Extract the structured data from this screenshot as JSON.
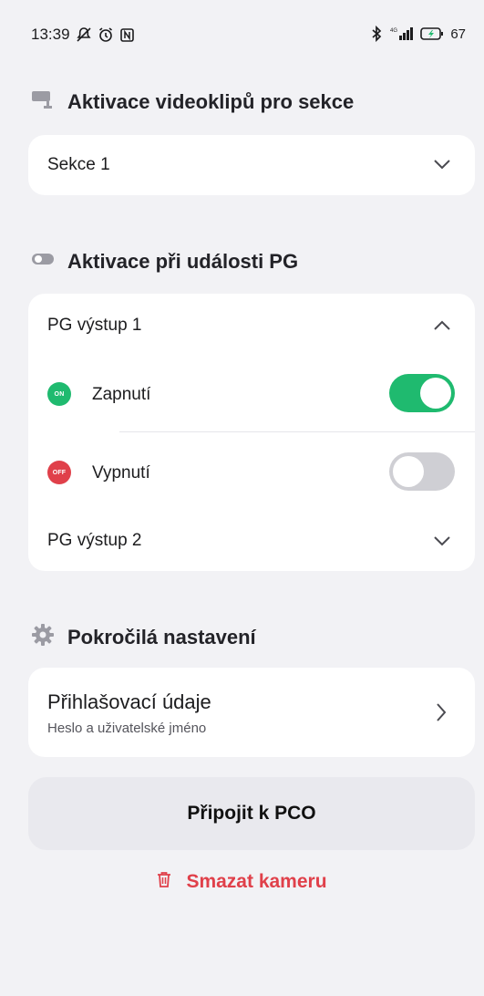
{
  "status_bar": {
    "time": "13:39",
    "battery": "67",
    "network": "4G"
  },
  "sections": {
    "video": {
      "title": "Aktivace videoklipů pro sekce",
      "icon": "cctv-camera-icon",
      "dropdown_value": "Sekce 1"
    },
    "pg": {
      "title": "Aktivace při události PG",
      "icon": "toggle-icon",
      "output1_label": "PG výstup 1",
      "on_badge": "ON",
      "on_label": "Zapnutí",
      "on_state": true,
      "off_badge": "OFF",
      "off_label": "Vypnutí",
      "off_state": false,
      "output2_label": "PG výstup 2"
    },
    "advanced": {
      "title": "Pokročilá nastavení",
      "icon": "gear-icon",
      "credentials_title": "Přihlašovací údaje",
      "credentials_subtitle": "Heslo a uživatelské jméno"
    }
  },
  "actions": {
    "connect_label": "Připojit k PCO",
    "delete_label": "Smazat kameru"
  },
  "colors": {
    "accent_green": "#1fba6f",
    "danger_red": "#e0404a",
    "toggle_off": "#cfcfd4"
  }
}
